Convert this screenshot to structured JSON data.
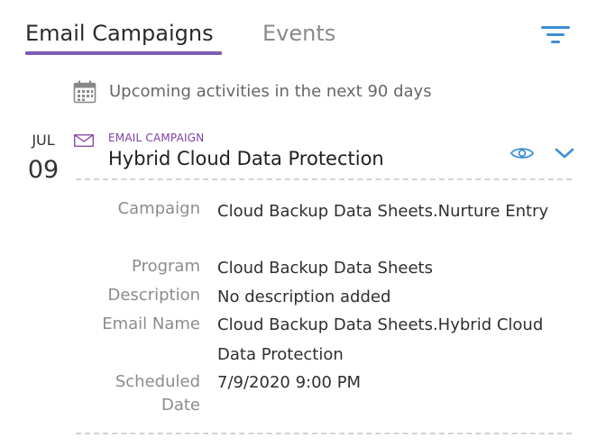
{
  "tabs": [
    {
      "label": "Email Campaigns",
      "active": true
    },
    {
      "label": "Events",
      "active": false
    }
  ],
  "icons": {
    "filter": "filter-icon",
    "calendar": "calendar-icon",
    "mail": "mail-icon",
    "eye": "eye-icon",
    "chevron": "chevron-down-icon"
  },
  "colors": {
    "accent_purple": "#7f5cb3",
    "activity_type": "#7f3fa8",
    "icon_blue": "#3d8fd6"
  },
  "upcoming": {
    "text": "Upcoming activities in the next 90 days"
  },
  "activity": {
    "date": {
      "month": "JUL",
      "day": "09"
    },
    "type": "EMAIL CAMPAIGN",
    "title": "Hybrid Cloud Data Protection",
    "details": [
      {
        "label": "Campaign",
        "value": "Cloud Backup Data Sheets.Nurture Entry"
      },
      {
        "label": "Program",
        "value": "Cloud Backup Data Sheets"
      },
      {
        "label": "Description",
        "value": "No description added"
      },
      {
        "label": "Email Name",
        "value": "Cloud Backup Data Sheets.Hybrid Cloud Data Protection"
      },
      {
        "label": "Scheduled Date",
        "value": "7/9/2020 9:00 PM"
      }
    ]
  }
}
